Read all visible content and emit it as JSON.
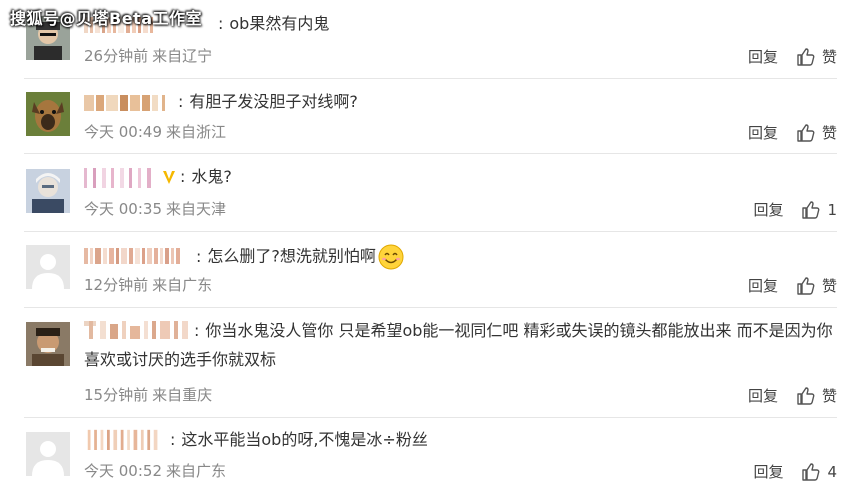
{
  "watermark": "搜狐号@贝塔Beta工作室",
  "reply_label": "回复",
  "like_label": "赞",
  "colors": {
    "text": "#333333",
    "meta": "#888888",
    "divider": "#e6e6e6",
    "badge": "#f5b800"
  },
  "comments": [
    {
      "text": "ob果然有内鬼",
      "time": "26分钟前",
      "location": "来自辽宁",
      "likes": "赞"
    },
    {
      "text": "有胆子发没胆子对线啊?",
      "time": "今天 00:49",
      "location": "来自浙江",
      "likes": "赞"
    },
    {
      "text": "水鬼?",
      "time": "今天 00:35",
      "location": "来自天津",
      "likes": "1"
    },
    {
      "text": "怎么删了?想洗就别怕啊",
      "time": "12分钟前",
      "location": "来自广东",
      "likes": "赞"
    },
    {
      "text": "你当水鬼没人管你 只是希望ob能一视同仁吧 精彩或失误的镜头都能放出来 而不是因为你喜欢或讨厌的选手你就双标",
      "time": "15分钟前",
      "location": "来自重庆",
      "likes": "赞"
    },
    {
      "text": "这水平能当ob的呀,不愧是冰÷粉丝",
      "time": "今天 00:52",
      "location": "来自广东",
      "likes": "4"
    }
  ]
}
